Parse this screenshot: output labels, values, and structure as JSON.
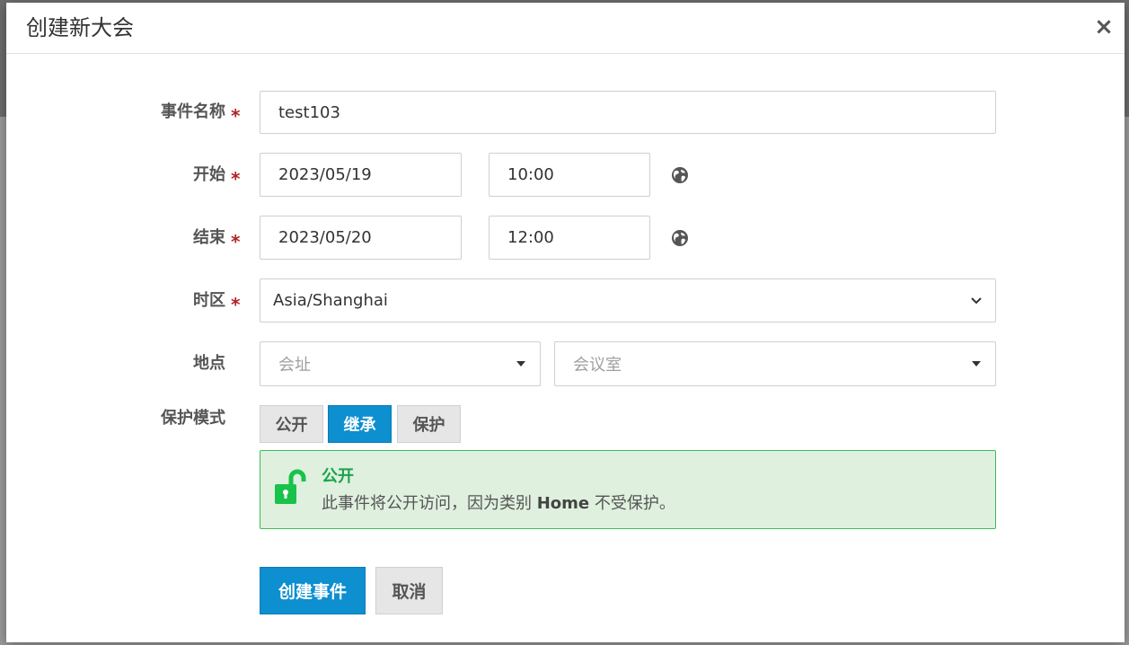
{
  "dialog": {
    "title": "创建新大会",
    "close_label": "×"
  },
  "form": {
    "title_label": "事件名称",
    "title_value": "test103",
    "start_label": "开始",
    "start_date": "2023/05/19",
    "start_time": "10:00",
    "end_label": "结束",
    "end_date": "2023/05/20",
    "end_time": "12:00",
    "timezone_label": "时区",
    "timezone_value": "Asia/Shanghai",
    "location_label": "地点",
    "venue_placeholder": "会址",
    "room_placeholder": "会议室",
    "protection_label": "保护模式",
    "required_mark": "*"
  },
  "protection": {
    "options": [
      "公开",
      "继承",
      "保护"
    ],
    "selected": "继承",
    "info_title": "公开",
    "info_text_before": "此事件将公开访问，因为类别 ",
    "info_category": "Home",
    "info_text_after": " 不受保护。"
  },
  "actions": {
    "create_label": "创建事件",
    "cancel_label": "取消"
  },
  "colors": {
    "primary": "#0d8fd0",
    "success_border": "#3fba57",
    "success_bg": "#dff0df",
    "success_text": "#19a34b",
    "required": "#b22222"
  },
  "icons": {
    "close": "close-icon",
    "globe": "globe-icon",
    "lock": "unlock-icon",
    "dropdown": "caret-down-icon"
  }
}
